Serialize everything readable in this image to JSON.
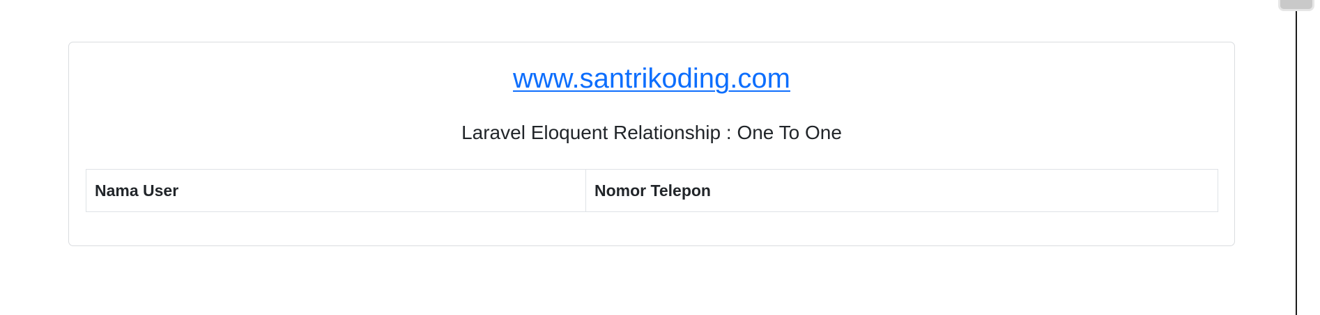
{
  "header": {
    "site_link": "www.santrikoding.com",
    "subtitle": "Laravel Eloquent Relationship : One To One"
  },
  "table": {
    "columns": [
      "Nama User",
      "Nomor Telepon"
    ],
    "rows": []
  },
  "colors": {
    "link": "#0d6efd",
    "text": "#212529",
    "border": "#dee2e6"
  }
}
